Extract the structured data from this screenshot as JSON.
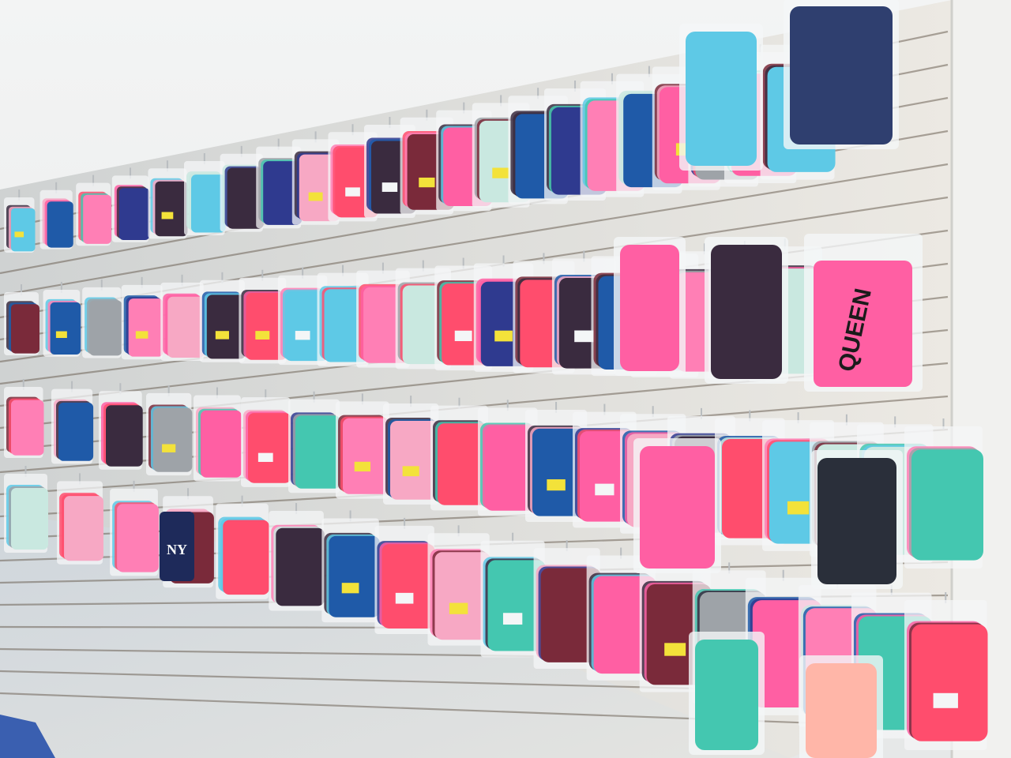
{
  "scene": {
    "subject": "phone-case-slatwall",
    "colors": {
      "ceiling": "#eef0f0",
      "wall_panel": "#e9e6e0",
      "slat_groove": "#6e6357",
      "lower_wall": "#dcdedf",
      "right_wall": "#f1f1ef",
      "floor_tile": "#3a5fb0",
      "bag_plastic": "#f4f6f7",
      "hook_metal": "#b9bdc0"
    },
    "case_palette": [
      "#ff5fa3",
      "#5ec9e6",
      "#2f3a8f",
      "#44c7b0",
      "#ff4d6d",
      "#3a2b3f",
      "#f7a8c4",
      "#7a2a3a",
      "#9ea3a8",
      "#ff7fb5",
      "#1f5aa8",
      "#c9e8e0"
    ],
    "visible_text": {
      "queen_case_print": "QUEEN",
      "ny_case_print": "NY",
      "price_tag_text": ""
    }
  }
}
